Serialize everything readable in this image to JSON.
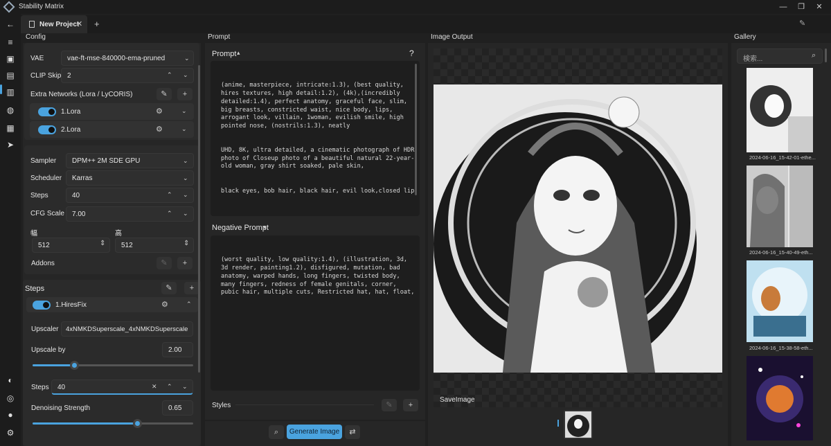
{
  "app": {
    "title": "Stability Matrix"
  },
  "tabs": [
    {
      "label": "New Project"
    }
  ],
  "panels": {
    "config": "Config",
    "prompt": "Prompt",
    "image_output": "Image Output",
    "gallery": "Gallery"
  },
  "config": {
    "vae_label": "VAE",
    "vae_value": "vae-ft-mse-840000-ema-pruned",
    "clip_skip_label": "CLIP Skip",
    "clip_skip_value": "2",
    "extra_networks_label": "Extra Networks (Lora / LyCORIS)",
    "loras": [
      {
        "label": "1.Lora"
      },
      {
        "label": "2.Lora"
      }
    ],
    "sampler_label": "Sampler",
    "sampler_value": "DPM++ 2M SDE GPU",
    "scheduler_label": "Scheduler",
    "scheduler_value": "Karras",
    "steps_label": "Steps",
    "steps_value": "40",
    "cfg_label": "CFG Scale",
    "cfg_value": "7.00",
    "width_label": "幅",
    "width_value": "512",
    "height_label": "高",
    "height_value": "512",
    "addons_label": "Addons",
    "steps_section_label": "Steps",
    "hiresfix_label": "1.HiresFix",
    "upscaler_label": "Upscaler",
    "upscaler_value": "4xNMKDSuperscale_4xNMKDSuperscale",
    "upscale_by_label": "Upscale by",
    "upscale_by_value": "2.00",
    "upscale_by_fraction": 0.26,
    "hires_steps_label": "Steps",
    "hires_steps_value": "40",
    "denoise_label": "Denoising Strength",
    "denoise_value": "0.65",
    "denoise_fraction": 0.65
  },
  "prompt": {
    "prompt_label": "Prompt",
    "help": "?",
    "positive_lines": [
      "(anime, masterpiece, intricate:1.3), (best quality, hires textures, high detail:1.2), (4k),(incredibly detailed:1.4), perfect anatomy, graceful face, slim, big breasts, constricted waist, nice body, lips, arrogant look, villain, 1woman, evilish smile, high pointed nose, (nostrils:1.3), neatly",
      "UHD, 8K, ultra detailed, a cinematic photograph of HDR photo of Closeup photo of a beautiful natural 22-year-old woman, gray shirt soaked, pale skin,",
      "black eyes, bob hair, black hair, evil look,closed lip"
    ],
    "negative_label": "Negative Prompt",
    "negative_lines": [
      "(worst quality, low quality:1.4), (illustration, 3d, 3d render, painting1.2), disfigured, mutation, bad anatomy, warped hands, long fingers, twisted body, many fingers, redness of female genitals, corner, pubic hair, multiple cuts, Restricted hat, hat, float,"
    ],
    "styles_label": "Styles",
    "generate_label": "Generate Image"
  },
  "output": {
    "save_label": "SaveImage"
  },
  "gallery": {
    "search_placeholder": "検索...",
    "items": [
      {
        "caption": "2024-06-16_15-42-01-ethe..."
      },
      {
        "caption": "2024-06-16_15-40-49-eth..."
      },
      {
        "caption": "2024-06-16_15-38-58-eth..."
      },
      {
        "caption": ""
      }
    ]
  }
}
